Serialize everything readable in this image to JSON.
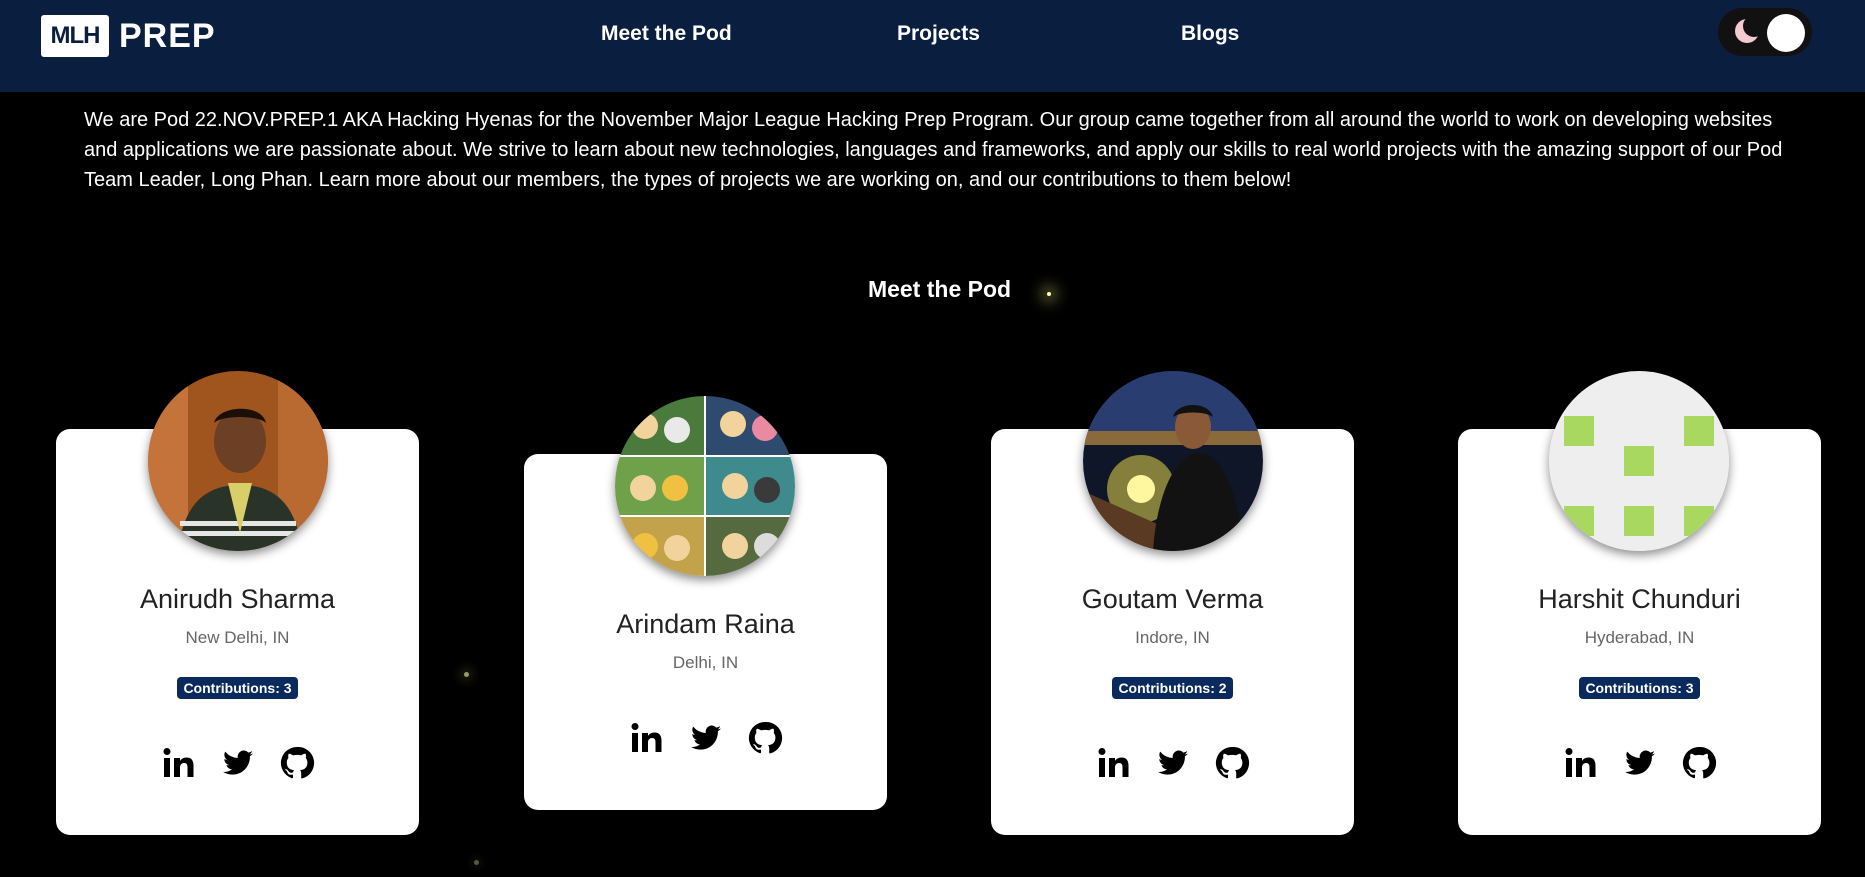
{
  "nav": {
    "logo_box": "MLH",
    "logo_text": "PREP",
    "links": [
      "Meet the Pod",
      "Projects",
      "Blogs"
    ]
  },
  "theme_toggle": {
    "icon": "moon-icon",
    "state": "dark"
  },
  "intro_text": "We are Pod 22.NOV.PREP.1 AKA Hacking Hyenas for the November Major League Hacking Prep Program. Our group came together from all around the world to work on developing websites and applications we are passionate about. We strive to learn about new technologies, languages and frameworks, and apply our skills to real world projects with the amazing support of our Pod Team Leader, Long Phan. Learn more about our members, the types of projects we are working on, and our contributions to them below!",
  "section_title": "Meet the Pod",
  "members": [
    {
      "name": "Anirudh Sharma",
      "location": "New Delhi, IN",
      "contributions": "Contributions: 3",
      "social_icons": [
        "linkedin-icon",
        "twitter-icon",
        "github-icon"
      ]
    },
    {
      "name": "Arindam Raina",
      "location": "Delhi, IN",
      "contributions": "",
      "social_icons": [
        "linkedin-icon",
        "twitter-icon",
        "github-icon"
      ]
    },
    {
      "name": "Goutam Verma",
      "location": "Indore, IN",
      "contributions": "Contributions: 2",
      "social_icons": [
        "linkedin-icon",
        "twitter-icon",
        "github-icon"
      ]
    },
    {
      "name": "Harshit Chunduri",
      "location": "Hyderabad, IN",
      "contributions": "Contributions: 3",
      "social_icons": [
        "linkedin-icon",
        "twitter-icon",
        "github-icon"
      ]
    }
  ],
  "colors": {
    "navbar": "#0a1f3f",
    "background": "#000000",
    "badge": "#0a2a5e",
    "identicon": "#a8d860"
  }
}
